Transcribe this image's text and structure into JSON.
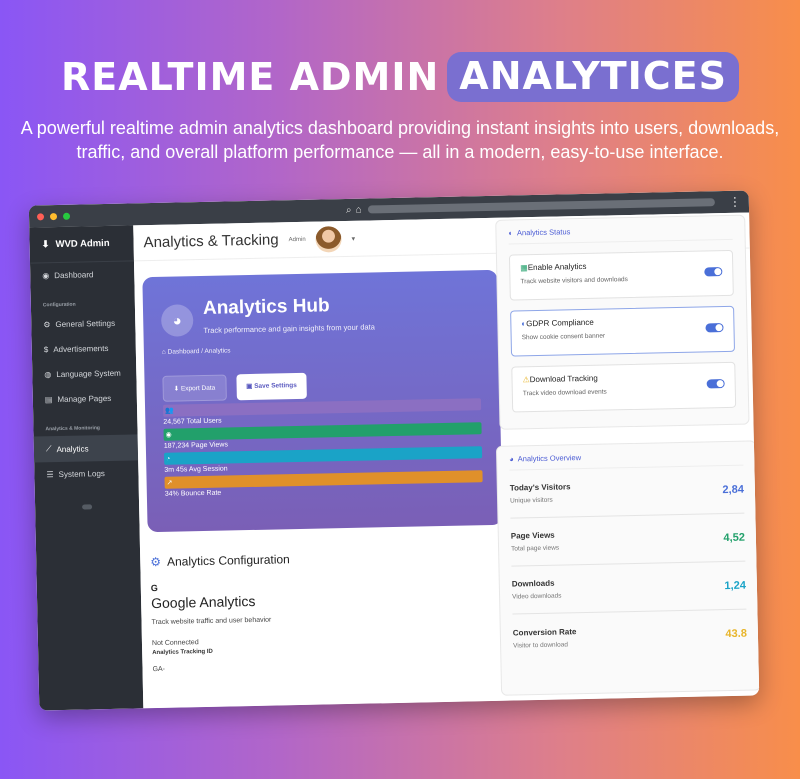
{
  "hero": {
    "title_plain": "REALTIME ADMIN",
    "title_highlight": "ANALYTICES",
    "subtitle": "A powerful realtime admin analytics dashboard providing instant insights into users, downloads, traffic, and overall platform performance — all in a modern, easy-to-use interface."
  },
  "sidebar": {
    "brand": "WVD Admin",
    "dashboard": "Dashboard",
    "section_config": "Configuration",
    "general_settings": "General Settings",
    "advertisements": "Advertisements",
    "language_system": "Language System",
    "manage_pages": "Manage Pages",
    "section_analytics": "Analytics & Monitoring",
    "analytics": "Analytics",
    "system_logs": "System Logs"
  },
  "header": {
    "title": "Analytics & Tracking",
    "admin_label": "Admin"
  },
  "hub": {
    "title": "Analytics Hub",
    "description": "Track performance and gain insights from your data",
    "crumb_dashboard": "Dashboard",
    "crumb_sep": "/",
    "crumb_current": "Analytics",
    "export_label": "Export Data",
    "save_label": "Save Settings",
    "stats": [
      {
        "label": "24,567 Total Users",
        "color": "#8b6fc2",
        "icon": "👥"
      },
      {
        "label": "187,234 Page Views",
        "color": "#22a06b",
        "icon": "◉"
      },
      {
        "label": "3m 45s Avg Session",
        "color": "#1aa3c7",
        "icon": "◔"
      },
      {
        "label": "34% Bounce Rate",
        "color": "#e0902a",
        "icon": "↗"
      }
    ]
  },
  "config": {
    "title": "Analytics Configuration",
    "g_letter": "G",
    "ga_title": "Google Analytics",
    "ga_desc": "Track website traffic and user behavior",
    "ga_status": "Not Connected",
    "ga_id_label": "Analytics Tracking ID",
    "ga_value": "GA-"
  },
  "status_panel": {
    "title": "Analytics Status",
    "cards": [
      {
        "title": "Enable Analytics",
        "desc": "Track website visitors and downloads",
        "icon": "▦"
      },
      {
        "title": "GDPR Compliance",
        "desc": "Show cookie consent banner",
        "icon": "◐"
      },
      {
        "title": "Download Tracking",
        "desc": "Track video download events",
        "icon": "⚠"
      }
    ]
  },
  "overview": {
    "title": "Analytics Overview",
    "rows": [
      {
        "name": "Today's Visitors",
        "sub": "Unique visitors",
        "value": "2,84",
        "color": "#4a6fd8"
      },
      {
        "name": "Page Views",
        "sub": "Total page views",
        "value": "4,52",
        "color": "#22a06b"
      },
      {
        "name": "Downloads",
        "sub": "Video downloads",
        "value": "1,24",
        "color": "#1aa3c7"
      },
      {
        "name": "Conversion Rate",
        "sub": "Visitor to download",
        "value": "43.8",
        "color": "#e8b52a"
      }
    ]
  }
}
